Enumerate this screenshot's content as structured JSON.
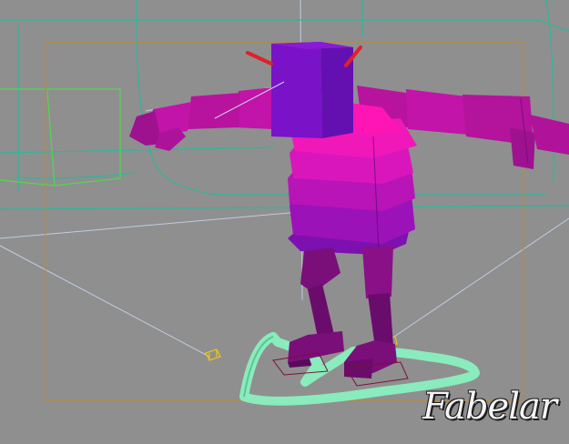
{
  "viewport": {
    "background": "#8f8f8f",
    "render_style": "wireframe-shaded perspective viewport",
    "watermark": "Fabelar"
  },
  "colors": {
    "wire_teal": "#2bb89a",
    "wire_green": "#4fd94f",
    "safe_frame": "#b88a3a",
    "light_line": "#c9d8f0",
    "head": "#7a12c8",
    "body_top": "#ff14b4",
    "body_mid": "#c515b8",
    "body_low": "#9b12b8",
    "legs": "#7a0f7a",
    "antenna": "#e0202a",
    "ground_ring": "#8af0c0",
    "helper_yellow": "#e8c21c"
  },
  "model": {
    "name_icon": "robot-character",
    "parts": [
      "head",
      "antenna-left",
      "antenna-right",
      "torso",
      "arm-left",
      "arm-right",
      "leg-left",
      "leg-right",
      "foot-left",
      "foot-right"
    ]
  },
  "helpers": [
    "spotlight-cone",
    "target-gizmo",
    "ground-control-ring",
    "safe-frame"
  ]
}
